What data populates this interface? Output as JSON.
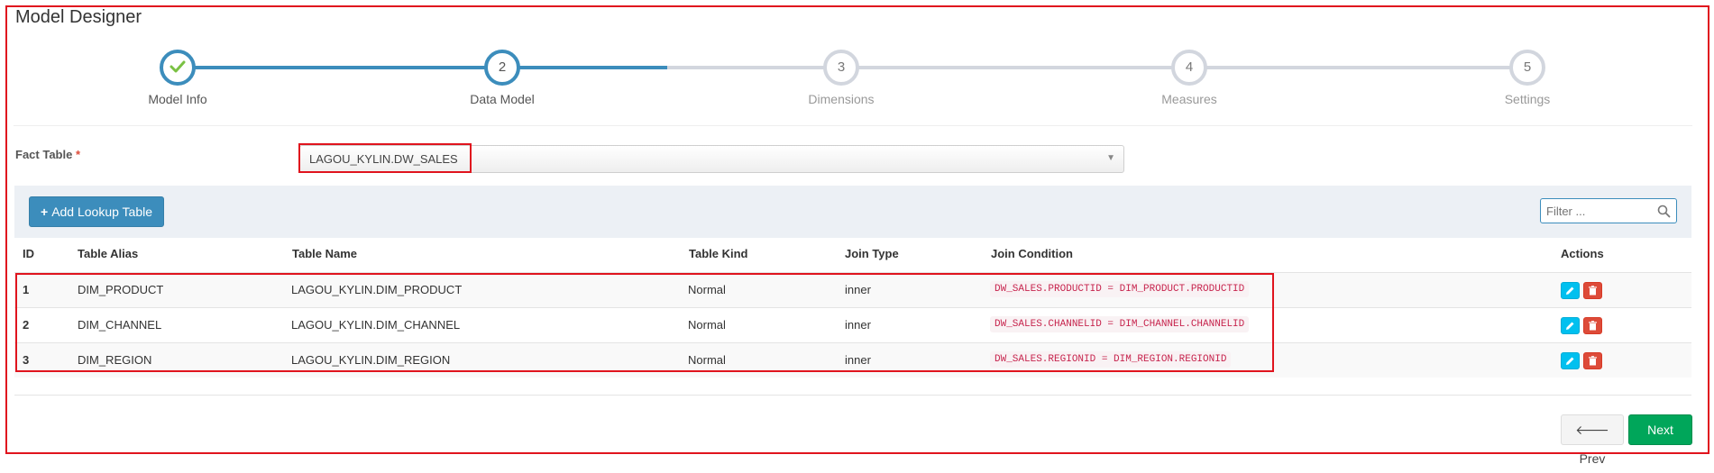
{
  "page": {
    "title": "Model Designer"
  },
  "wizard": {
    "steps": [
      {
        "number": "1",
        "label": "Model Info",
        "state": "completed",
        "icon": "check-icon"
      },
      {
        "number": "2",
        "label": "Data Model",
        "state": "active"
      },
      {
        "number": "3",
        "label": "Dimensions",
        "state": "pending"
      },
      {
        "number": "4",
        "label": "Measures",
        "state": "pending"
      },
      {
        "number": "5",
        "label": "Settings",
        "state": "pending"
      }
    ],
    "progress_percent": 30
  },
  "fact_table": {
    "label": "Fact Table",
    "required_mark": "*",
    "value": "LAGOU_KYLIN.DW_SALES"
  },
  "toolbar": {
    "add_button_label": "Add Lookup Table",
    "filter_placeholder": "Filter ..."
  },
  "table": {
    "headers": {
      "id": "ID",
      "alias": "Table Alias",
      "name": "Table Name",
      "kind": "Table Kind",
      "join_type": "Join Type",
      "join_condition": "Join Condition",
      "actions": "Actions"
    },
    "rows": [
      {
        "id": "1",
        "alias": "DIM_PRODUCT",
        "name": "LAGOU_KYLIN.DIM_PRODUCT",
        "kind": "Normal",
        "join_type": "inner",
        "join_condition": "DW_SALES.PRODUCTID = DIM_PRODUCT.PRODUCTID"
      },
      {
        "id": "2",
        "alias": "DIM_CHANNEL",
        "name": "LAGOU_KYLIN.DIM_CHANNEL",
        "kind": "Normal",
        "join_type": "inner",
        "join_condition": "DW_SALES.CHANNELID = DIM_CHANNEL.CHANNELID"
      },
      {
        "id": "3",
        "alias": "DIM_REGION",
        "name": "LAGOU_KYLIN.DIM_REGION",
        "kind": "Normal",
        "join_type": "inner",
        "join_condition": "DW_SALES.REGIONID = DIM_REGION.REGIONID"
      }
    ]
  },
  "footer": {
    "prev_label": "Prev",
    "next_label": "Next"
  },
  "colors": {
    "primary": "#3c8dbc",
    "success": "#00a65a",
    "danger": "#dd4b39",
    "info": "#00c0ef",
    "highlight": "#e0141e",
    "check": "#7ac143"
  }
}
